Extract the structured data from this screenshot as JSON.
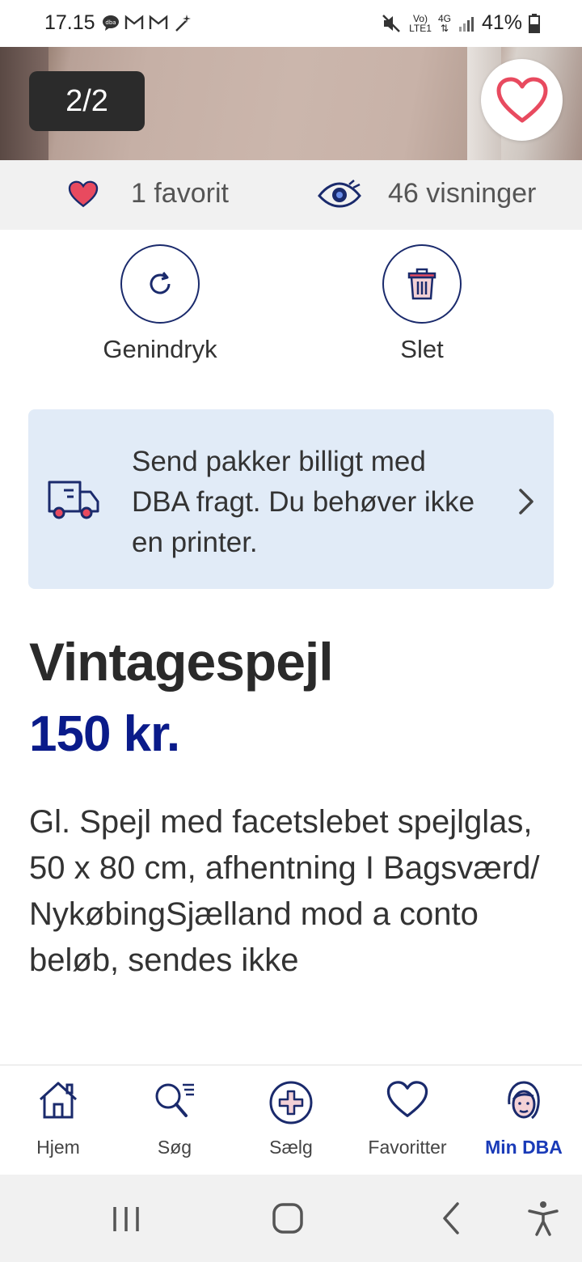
{
  "status_bar": {
    "time": "17.15",
    "notification_icons": [
      "dba-chat-icon",
      "gmail-icon",
      "gmail-icon",
      "magic-wand-icon"
    ],
    "network_top": "Vo)",
    "network_bottom": "LTE1",
    "network_type": "4G",
    "battery": "41%"
  },
  "gallery": {
    "counter": "2/2"
  },
  "stats": {
    "favorites": "1 favorit",
    "views": "46 visninger"
  },
  "actions": {
    "renew_label": "Genindryk",
    "delete_label": "Slet"
  },
  "shipping_banner": {
    "text": "Send pakker billigt med DBA fragt. Du behøver ikke en printer."
  },
  "listing": {
    "title": "Vintagespejl",
    "price": "150 kr.",
    "description": "Gl. Spejl med facetslebet spejlglas, 50 x 80 cm, afhentning I Bagsværd/ NykøbingSjælland mod a conto beløb, sendes ikke"
  },
  "bottom_nav": {
    "items": [
      {
        "label": "Hjem",
        "icon": "home-icon"
      },
      {
        "label": "Søg",
        "icon": "search-icon"
      },
      {
        "label": "Sælg",
        "icon": "plus-circle-icon"
      },
      {
        "label": "Favoritter",
        "icon": "heart-icon"
      },
      {
        "label": "Min DBA",
        "icon": "profile-icon"
      }
    ],
    "active_index": 4
  },
  "colors": {
    "brand_blue": "#0a1b8a",
    "active_nav": "#1a3bb8",
    "heart_red": "#e84a5f",
    "banner_bg": "#e1ebf7"
  }
}
